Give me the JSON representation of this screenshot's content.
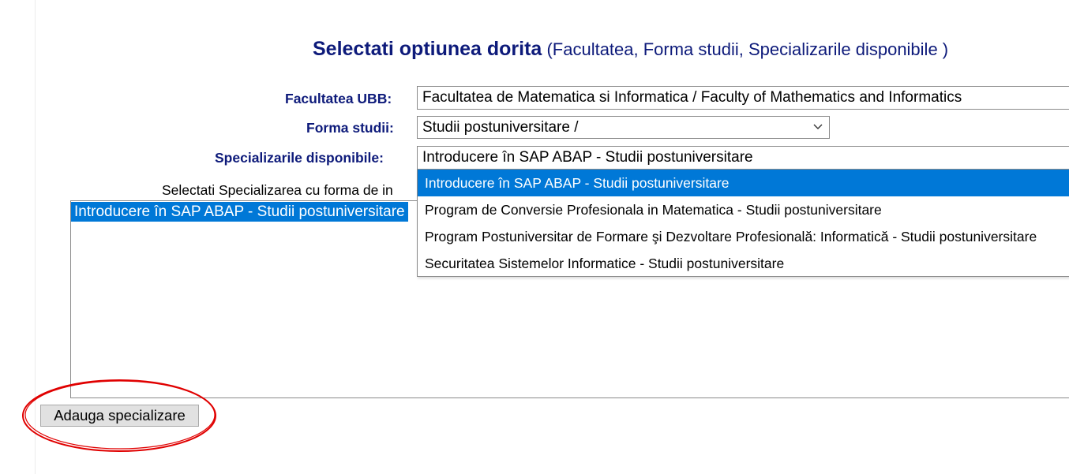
{
  "heading": {
    "main": "Selectati optiunea dorita",
    "sub": " (Facultatea, Forma studii, Specializarile disponibile )"
  },
  "form": {
    "faculty_label": "Facultatea UBB:",
    "faculty_value": "Facultatea de Matematica si Informatica / Faculty of Mathematics and Informatics",
    "study_label": "Forma studii:",
    "study_value": "Studii postuniversitare /",
    "spec_label": "Specializarile disponibile:",
    "spec_value": "Introducere în SAP ABAP - Studii postuniversitare"
  },
  "dropdown": {
    "options": [
      "Introducere în SAP ABAP - Studii postuniversitare",
      "Program de Conversie Profesionala in Matematica - Studii postuniversitare",
      "Program Postuniversitar de Formare şi Dezvoltare Profesională: Informatică - Studii postuniversitare",
      "Securitatea Sistemelor Informatice - Studii postuniversitare"
    ],
    "highlighted_index": 0
  },
  "selection": {
    "helper_text": "Selectati Specializarea cu forma de in",
    "items": [
      "Introducere în SAP ABAP - Studii postuniversitare"
    ]
  },
  "actions": {
    "add_label": "Adauga specializare"
  },
  "colors": {
    "label_blue": "#0d1a7a",
    "highlight": "#0078d7",
    "annotation": "#e00000"
  }
}
